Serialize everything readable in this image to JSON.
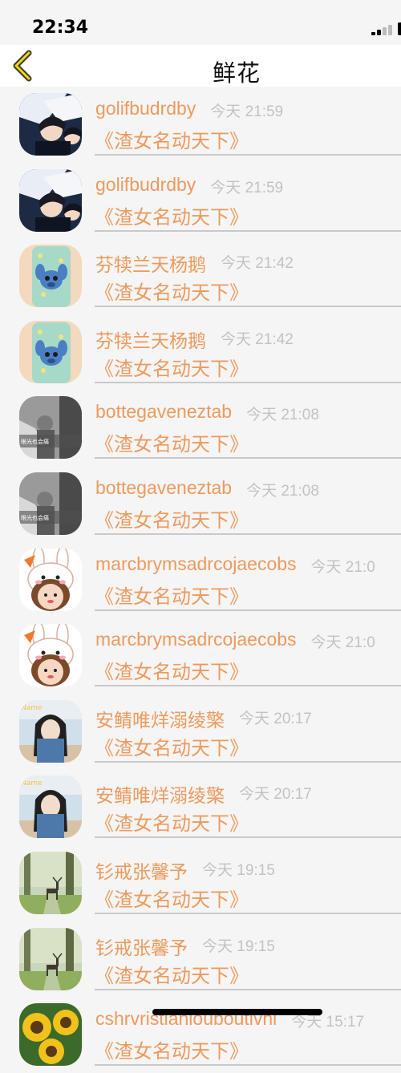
{
  "status": {
    "time": "22:34"
  },
  "nav": {
    "title": "鲜花"
  },
  "colors": {
    "accent": "#ed9a5e",
    "meta": "#c2c2c2",
    "divider": "#c9c9c9"
  },
  "rows": [
    {
      "user": "golifbudrdby",
      "time": "今天 21:59",
      "title": "《渣女名动天下》",
      "avatar": "anime-avatar"
    },
    {
      "user": "golifbudrdby",
      "time": "今天 21:59",
      "title": "《渣女名动天下》",
      "avatar": "anime-avatar"
    },
    {
      "user": "芬犊兰天杨鹅",
      "time": "今天 21:42",
      "title": "《渣女名动天下》",
      "avatar": "phone-case-avatar"
    },
    {
      "user": "芬犊兰天杨鹅",
      "time": "今天 21:42",
      "title": "《渣女名动天下》",
      "avatar": "phone-case-avatar"
    },
    {
      "user": "bottegaveneztab",
      "time": "今天 21:08",
      "title": "《渣女名动天下》",
      "avatar": "grayscale-photo-avatar"
    },
    {
      "user": "bottegaveneztab",
      "time": "今天 21:08",
      "title": "《渣女名动天下》",
      "avatar": "grayscale-photo-avatar"
    },
    {
      "user": "marcbrymsadrcojaecobs",
      "time": "今天 21:0",
      "title": "《渣女名动天下》",
      "avatar": "bunny-girl-avatar"
    },
    {
      "user": "marcbrymsadrcojaecobs",
      "time": "今天 21:0",
      "title": "《渣女名动天下》",
      "avatar": "bunny-girl-avatar"
    },
    {
      "user": "安鲭唯烊溺绫檠",
      "time": "今天 20:17",
      "title": "《渣女名动天下》",
      "avatar": "girl-photo-avatar"
    },
    {
      "user": "安鲭唯烊溺绫檠",
      "time": "今天 20:17",
      "title": "《渣女名动天下》",
      "avatar": "girl-photo-avatar"
    },
    {
      "user": "钐戒张馨予",
      "time": "今天 19:15",
      "title": "《渣女名动天下》",
      "avatar": "deer-forest-avatar"
    },
    {
      "user": "钐戒张馨予",
      "time": "今天 19:15",
      "title": "《渣女名动天下》",
      "avatar": "deer-forest-avatar"
    },
    {
      "user": "cshrvristianlouboutivnl",
      "time": "今天 15:17",
      "title": "《渣女名动天下》",
      "avatar": "sunflower-avatar"
    }
  ]
}
